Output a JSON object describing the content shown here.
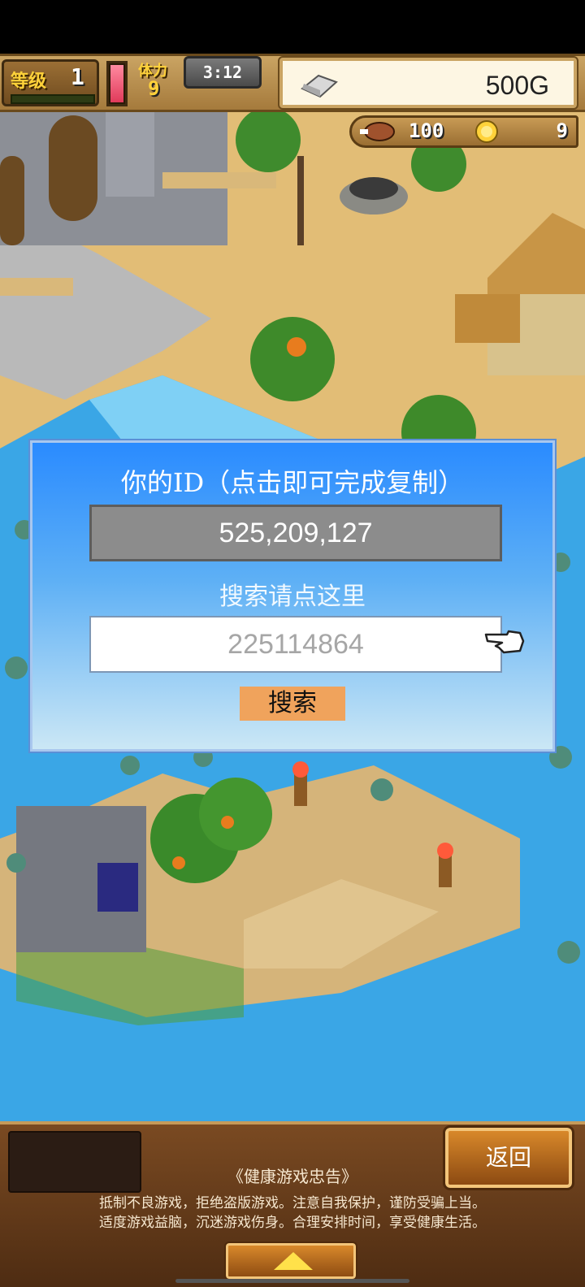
{
  "hud": {
    "level_label": "等级",
    "level_value": "1",
    "stamina_label": "体力",
    "stamina_value": "9",
    "timer": "3:12",
    "money": "500G",
    "food_value": "100",
    "medal_value": "9"
  },
  "dialog": {
    "title": "你的ID（点击即可完成复制）",
    "id_value": "525,209,127",
    "search_label": "搜索请点这里",
    "search_value": "225114864",
    "search_button": "搜索"
  },
  "bottom": {
    "back_button": "返回",
    "advice_title": "《健康游戏忠告》",
    "advice_line1": "抵制不良游戏，拒绝盗版游戏。注意自我保护，谨防受骗上当。",
    "advice_line2": "适度游戏益脑，沉迷游戏伤身。合理安排时间，享受健康生活。"
  },
  "colors": {
    "dialog_top": "#2a8bff",
    "dialog_bottom": "#cbe7f5",
    "search_button": "#f0a35c",
    "stamina": "#e03a5a",
    "sea": "#3aa6e6",
    "sand": "#e5c07a"
  },
  "icons": [
    "silver-ingot-icon",
    "roast-meat-icon",
    "gold-medal-icon",
    "pointing-hand-icon",
    "up-arrow-icon"
  ]
}
